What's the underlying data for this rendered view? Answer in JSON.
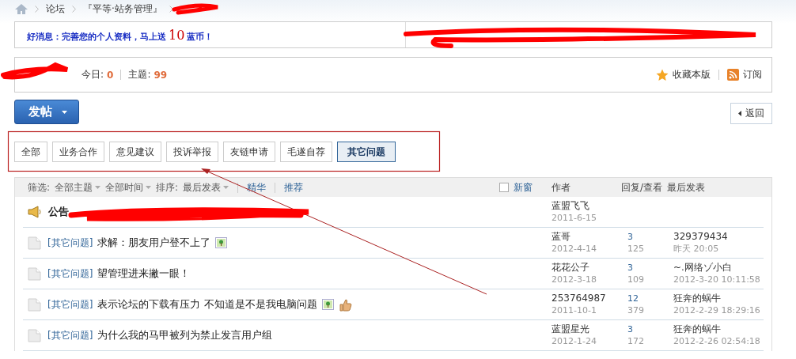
{
  "breadcrumb": [
    "论坛",
    "『平等·站务管理』"
  ],
  "notice": {
    "lead": "好消息：完善您的个人资料，马上送",
    "amount": "10",
    "tail": "蓝币！"
  },
  "forum": {
    "today_label": "今日:",
    "today": "0",
    "topics_label": "主题:",
    "topics": "99",
    "favorite": "收藏本版",
    "subscribe": "订阅"
  },
  "post_button": "发帖",
  "back_button": "返回",
  "tabs": [
    {
      "label": "全部",
      "selected": false
    },
    {
      "label": "业务合作",
      "selected": false
    },
    {
      "label": "意见建议",
      "selected": false
    },
    {
      "label": "投诉举报",
      "selected": false
    },
    {
      "label": "友链申请",
      "selected": false
    },
    {
      "label": "毛遂自荐",
      "selected": false
    },
    {
      "label": "其它问题",
      "selected": true
    }
  ],
  "filter": {
    "label": "筛选:",
    "dropdowns": [
      "全部主题",
      "全部时间"
    ],
    "sort_label": "排序:",
    "sort": "最后发表",
    "links": [
      "精华",
      "推荐"
    ],
    "new_window": {
      "label": "新窗",
      "checked": false
    }
  },
  "columns": [
    "作者",
    "回复/查看",
    "最后发表"
  ],
  "rows": [
    {
      "kind": "announcement",
      "label": "公告",
      "author": "蓝盟飞飞",
      "date": "2011-6-15"
    },
    {
      "kind": "thread",
      "tag": "[其它问题]",
      "title": "求解：朋友用户登不上了",
      "icons": [
        {
          "kind": "image"
        }
      ],
      "author": "蓝哥",
      "date": "2012-4-14",
      "replies": "3",
      "views": "125",
      "last_user": "329379434",
      "last_time": "昨天 20:05"
    },
    {
      "kind": "thread",
      "tag": "[其它问题]",
      "title": "望管理进来撇一眼！",
      "icons": [],
      "author": "花花公子",
      "date": "2012-3-18",
      "replies": "3",
      "views": "109",
      "last_user": "~.网络ゾ小白",
      "last_time": "2012-3-20 10:11:58"
    },
    {
      "kind": "thread",
      "tag": "[其它问题]",
      "title": "表示论坛的下载有压力 不知道是不是我电脑问题",
      "icons": [
        {
          "kind": "image"
        },
        {
          "kind": "thumb"
        }
      ],
      "author": "253764987",
      "date": "2011-10-1",
      "replies": "12",
      "views": "379",
      "last_user": "狂奔的蜗牛",
      "last_time": "2012-2-29 18:29:16"
    },
    {
      "kind": "thread",
      "tag": "[其它问题]",
      "title": "为什么我的马甲被列为禁止发言用户组",
      "icons": [],
      "author": "蓝盟星光",
      "date": "2012-1-24",
      "replies": "3",
      "views": "172",
      "last_user": "狂奔的蜗牛",
      "last_time": "2012-2-26 02:54:18"
    }
  ]
}
